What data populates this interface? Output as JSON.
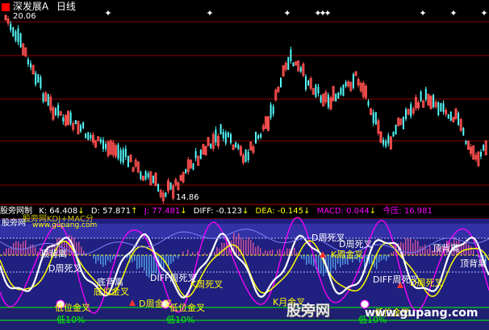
{
  "header": {
    "stock_name": "深发展A",
    "period": "日线"
  },
  "price_panel": {
    "high_label": "20.06",
    "low_label": "14.86",
    "colors": {
      "up": "#ff5050",
      "down": "#54fcfc",
      "star": "#ffffff",
      "grid": "#800000"
    }
  },
  "indicator_bar": {
    "name": "股旁网制",
    "k": "K: 64.408",
    "d": "D: 57.871",
    "j": "J: 77.481",
    "diff": "DIFF: -0.123",
    "dea": "DEA: -0.145",
    "macd": "MACD: 0.044",
    "jinya": "今压: 16.981"
  },
  "lower_panel": {
    "brand": "股旁网",
    "title_overlay": "股旁网KDJ+MAC分",
    "site": "www.gupang.com",
    "labels": [
      "顶背离",
      "D周死叉",
      "底背离",
      "底位金叉",
      "低位金叉",
      "D周金叉",
      "DIFF周死叉",
      "K周死叉",
      "D周死叉",
      "K周金叉",
      "顶背离",
      "DIFF周死叉",
      "D周死叉",
      "低位金叉",
      "K月金叉",
      "低位金叉",
      "顶背离",
      "D周死叉",
      "低10%",
      "低10%",
      "低10%"
    ]
  },
  "watermark": {
    "left": "股旁网",
    "right": "www.gupang.com"
  }
}
